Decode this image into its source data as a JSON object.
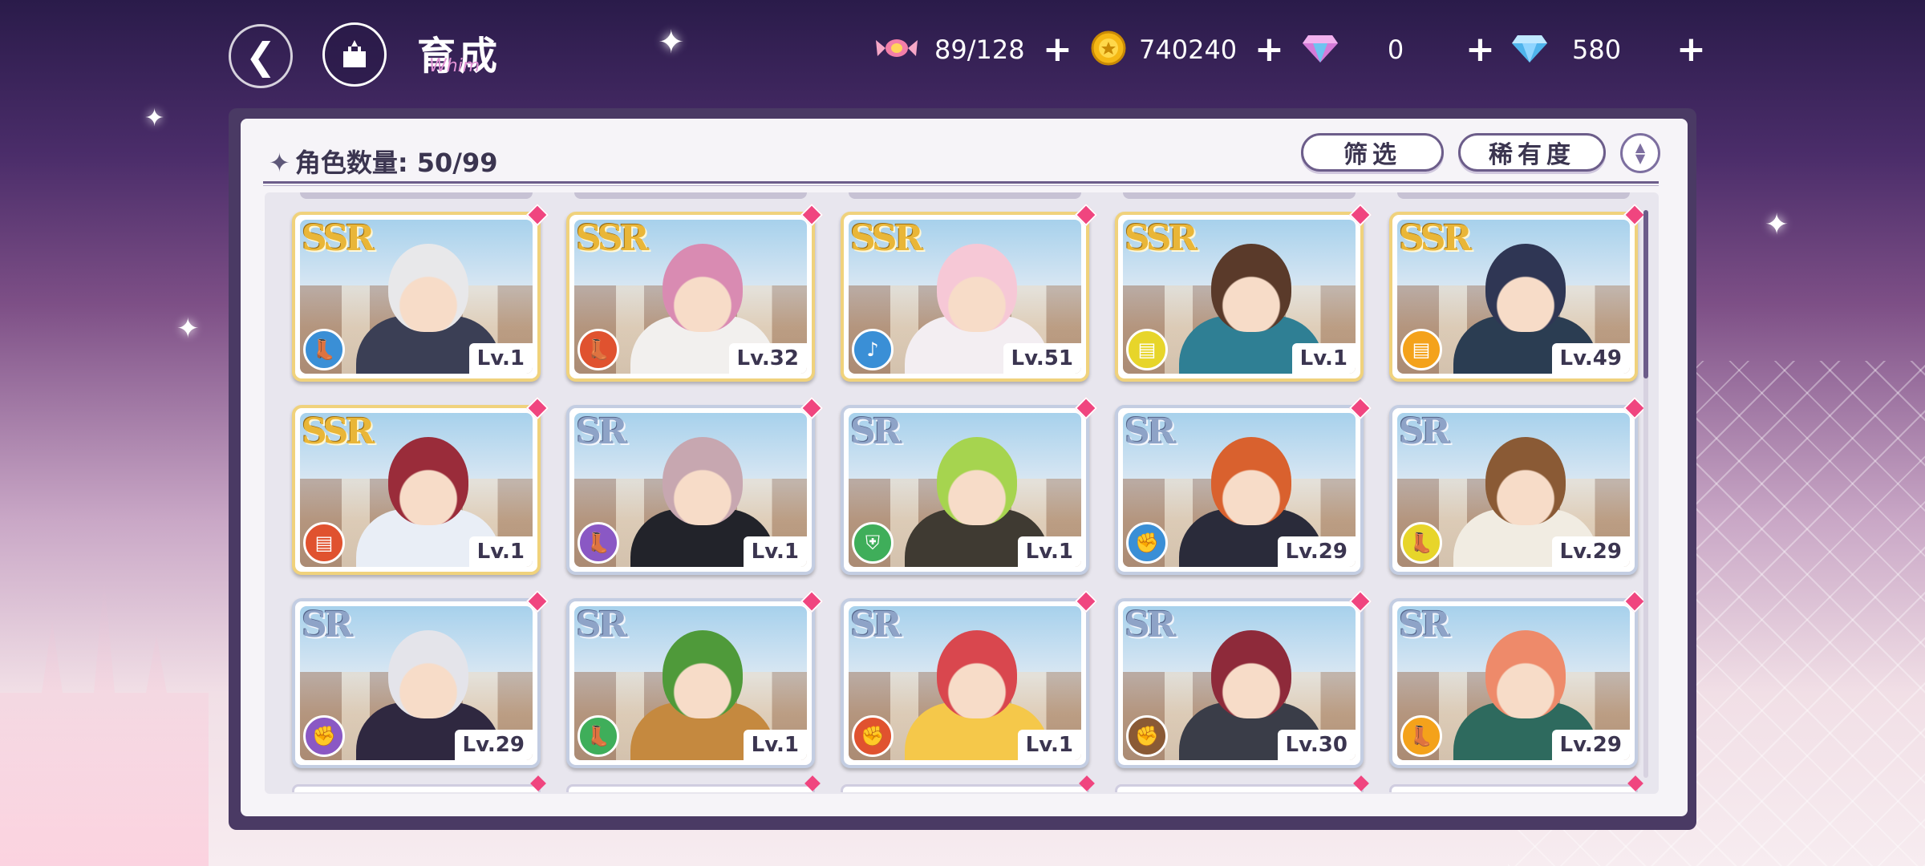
{
  "header": {
    "title": "育成",
    "title_decoration": "Whim"
  },
  "resources": {
    "candy": {
      "value": "89/128",
      "icon": "candy-icon"
    },
    "coin": {
      "value": "740240",
      "icon": "gold-coin-icon"
    },
    "pink_gem": {
      "value": "0",
      "icon": "pink-diamond-icon"
    },
    "blue_gem": {
      "value": "580",
      "icon": "blue-diamond-icon"
    }
  },
  "panel": {
    "count_label": "角色数量: 50/99",
    "filter_label": "筛选",
    "rarity_label": "稀有度"
  },
  "colors": {
    "ssr_gold": "#e9b638",
    "sr_silver": "#8ea3c7",
    "new_marker": "#f0457f",
    "panel_border": "#4a3a64"
  },
  "cards": [
    {
      "rarity": "SSR",
      "level": "Lv.1",
      "element": "blue",
      "hair": "#e8e8ea",
      "outfit": "#3b3f55",
      "icon": "boot-icon"
    },
    {
      "rarity": "SSR",
      "level": "Lv.32",
      "element": "red",
      "hair": "#d98bb2",
      "outfit": "#f2f0ee",
      "icon": "boot-icon"
    },
    {
      "rarity": "SSR",
      "level": "Lv.51",
      "element": "blue",
      "hair": "#f6c8d6",
      "outfit": "#f3eef2",
      "icon": "guitar-icon"
    },
    {
      "rarity": "SSR",
      "level": "Lv.1",
      "element": "yellow",
      "hair": "#5a3a2a",
      "outfit": "#2f7f94",
      "icon": "book-icon"
    },
    {
      "rarity": "SSR",
      "level": "Lv.49",
      "element": "orange",
      "hair": "#2f3654",
      "outfit": "#2b3d52",
      "icon": "book-icon"
    },
    {
      "rarity": "SSR",
      "level": "Lv.1",
      "element": "red",
      "hair": "#9a2c3a",
      "outfit": "#e9eef6",
      "icon": "book-icon"
    },
    {
      "rarity": "SR",
      "level": "Lv.1",
      "element": "purple",
      "hair": "#c7a7b0",
      "outfit": "#22232a",
      "icon": "boot-icon"
    },
    {
      "rarity": "SR",
      "level": "Lv.1",
      "element": "green",
      "hair": "#a6d44f",
      "outfit": "#3f3a32",
      "icon": "shield-icon"
    },
    {
      "rarity": "SR",
      "level": "Lv.29",
      "element": "blue",
      "hair": "#d9612e",
      "outfit": "#2a2b3a",
      "icon": "fist-icon"
    },
    {
      "rarity": "SR",
      "level": "Lv.29",
      "element": "yellow",
      "hair": "#8a5a35",
      "outfit": "#f1ece2",
      "icon": "boot-icon"
    },
    {
      "rarity": "SR",
      "level": "Lv.29",
      "element": "purple",
      "hair": "#e4e4ea",
      "outfit": "#2f2840",
      "icon": "fist-icon"
    },
    {
      "rarity": "SR",
      "level": "Lv.1",
      "element": "green",
      "hair": "#4f9a3a",
      "outfit": "#c5893f",
      "icon": "boot-icon"
    },
    {
      "rarity": "SR",
      "level": "Lv.1",
      "element": "red",
      "hair": "#d9474e",
      "outfit": "#f5c84a",
      "icon": "fist-icon"
    },
    {
      "rarity": "SR",
      "level": "Lv.30",
      "element": "brown",
      "hair": "#8e2a3a",
      "outfit": "#3a3d48",
      "icon": "fist-icon"
    },
    {
      "rarity": "SR",
      "level": "Lv.29",
      "element": "orange",
      "hair": "#ee8a6a",
      "outfit": "#2e6a5e",
      "icon": "boot-icon"
    }
  ],
  "element_colors": {
    "blue": "#3a8fd6",
    "red": "#e0522f",
    "yellow": "#e7d52a",
    "orange": "#f4a21b",
    "purple": "#8a58c4",
    "green": "#3fae5a",
    "brown": "#8a5a35"
  }
}
